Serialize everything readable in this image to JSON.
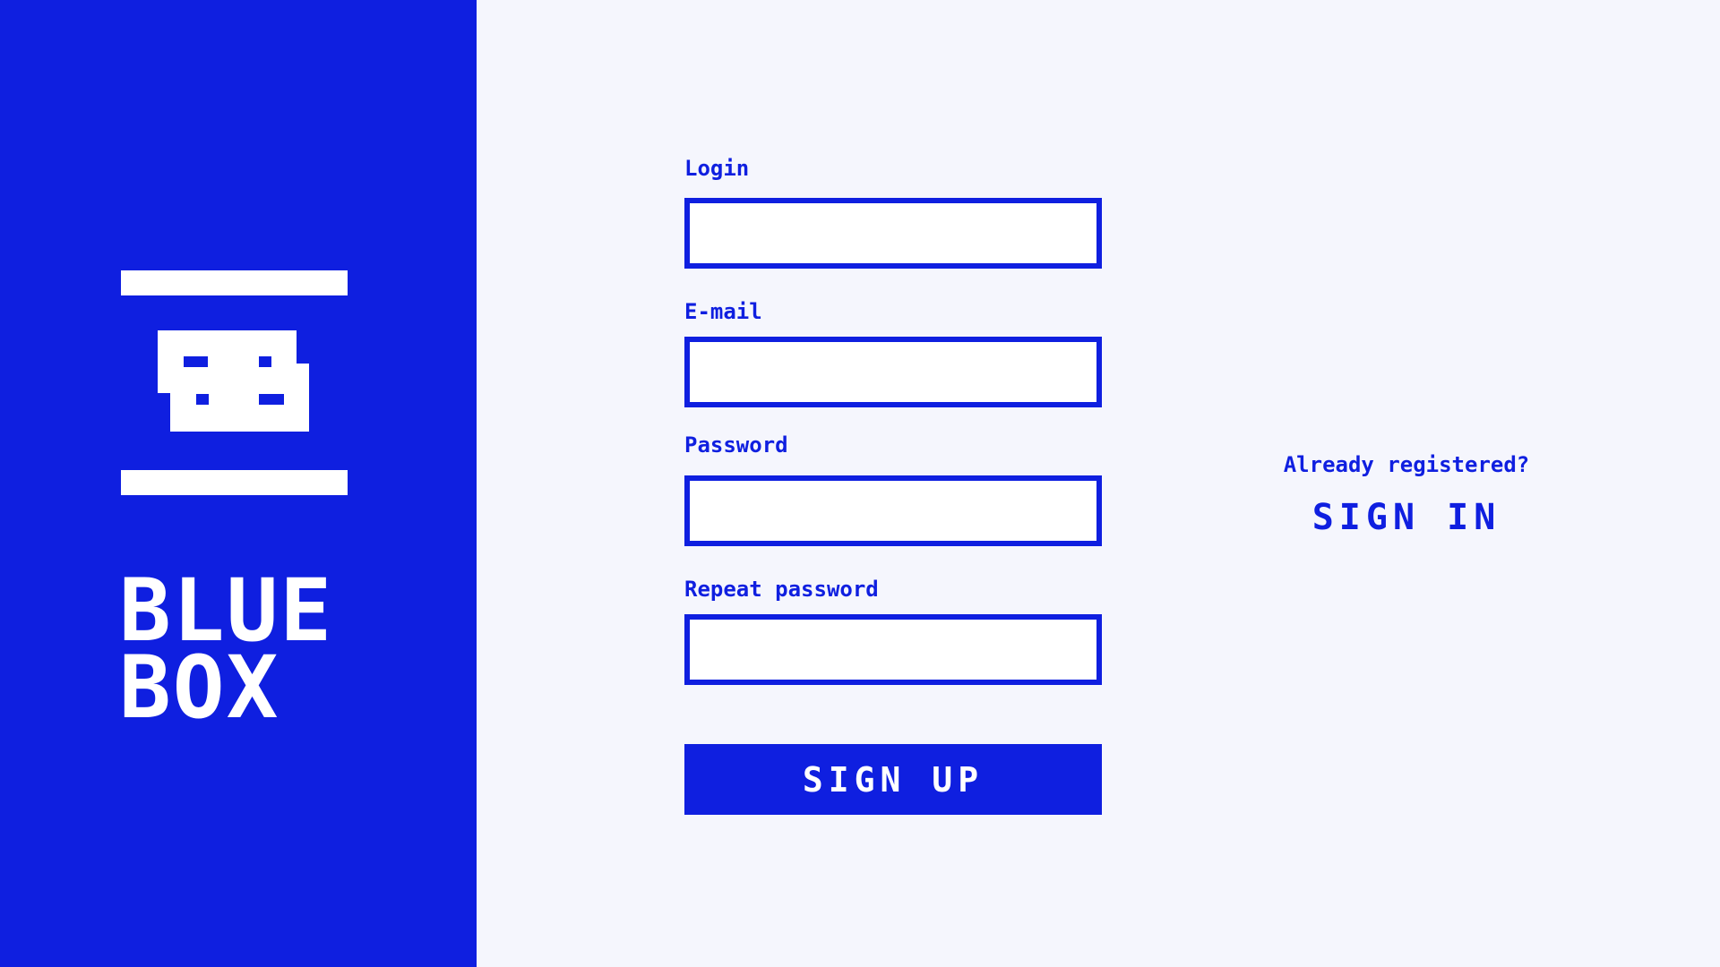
{
  "brand": {
    "logo_icon": "pixel-box-logo-icon",
    "name_line1": "BLUE",
    "name_line2": "BOX"
  },
  "form": {
    "login_label": "Login",
    "login_value": "",
    "email_label": "E-mail",
    "email_value": "",
    "password_label": "Password",
    "password_value": "",
    "repeat_password_label": "Repeat password",
    "repeat_password_value": "",
    "submit_label": "SIGN UP"
  },
  "signin": {
    "prompt": "Already registered?",
    "link_label": "SIGN IN"
  },
  "colors": {
    "brand_blue": "#0f1fe0",
    "background": "#f5f6fd",
    "white": "#ffffff"
  }
}
